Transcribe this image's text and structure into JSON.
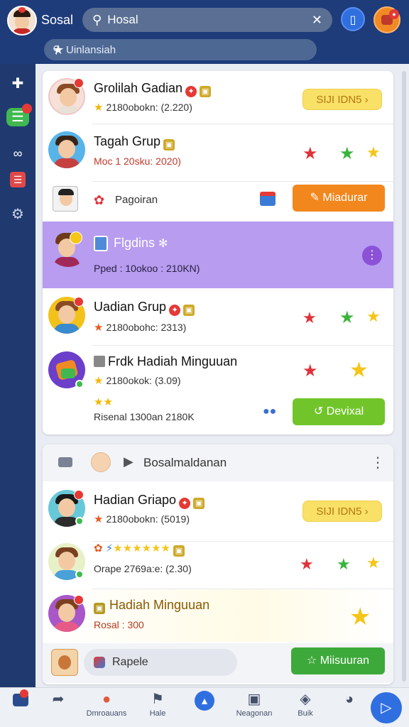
{
  "header": {
    "app_title": "Sosal",
    "search_value": "Hosal",
    "search_clear_icon": "close-icon",
    "sub_search_value": "Uinlansiah",
    "sub_search_star_icon": "star-icon"
  },
  "sidebar": {
    "items": [
      {
        "icon": "plus-icon"
      },
      {
        "icon": "chat-icon"
      },
      {
        "icon": "link-icon"
      },
      {
        "icon": "list-icon"
      },
      {
        "icon": "gear-icon"
      }
    ]
  },
  "card1": {
    "row1": {
      "title": "Grolilah Gadian",
      "meta": "2180obokn: (2.220)",
      "button": "SIJI IDN5"
    },
    "row2": {
      "title": "Tagah Grup",
      "meta": "Moc 1 20sku: 2020)"
    },
    "row3": {
      "label": "Pagoiran",
      "button": "Miadurar"
    },
    "row4": {
      "title": "Flgdins",
      "meta": "Pped : 10okoo : 210KN)"
    },
    "row5": {
      "title": "Uadian Grup",
      "meta": "2180obohc: 2313)"
    },
    "row6": {
      "title": "Frdk Hadiah Minguuan",
      "meta": "2180okok: (3.09)",
      "sub": "Risenal 1300an 2180K",
      "button": "Devixal"
    }
  },
  "card2": {
    "header_label": "Bosalmaldanan",
    "row1": {
      "title": "Hadian Griapo",
      "meta": "2180obokn: (5019)",
      "button": "SIJI IDN5"
    },
    "row2": {
      "meta": "Orape 2769a:e: (2.30)"
    },
    "row3": {
      "title": "Hadiah Minguuan",
      "meta": "Rosal : 300"
    },
    "row4": {
      "input": "Rapele",
      "button": "Miisuuran"
    }
  },
  "bottom_nav": {
    "items": [
      {
        "label": "",
        "icon": "chat-icon"
      },
      {
        "label": "",
        "icon": "share-icon"
      },
      {
        "label": "Dmroauans",
        "icon": "people-icon"
      },
      {
        "label": "Hale",
        "icon": "flag-icon"
      },
      {
        "label": "",
        "icon": "home-icon"
      },
      {
        "label": "Neagonan",
        "icon": "game-icon"
      },
      {
        "label": "Buik",
        "icon": "shield-icon"
      },
      {
        "label": "",
        "icon": "globe-icon"
      }
    ],
    "fab_icon": "send-icon"
  },
  "colors": {
    "topbar": "#1e3b7a",
    "sidebar": "#203a70",
    "accent_orange": "#f2871e",
    "accent_green": "#3da93a",
    "purple_highlight": "#b79cf0"
  }
}
